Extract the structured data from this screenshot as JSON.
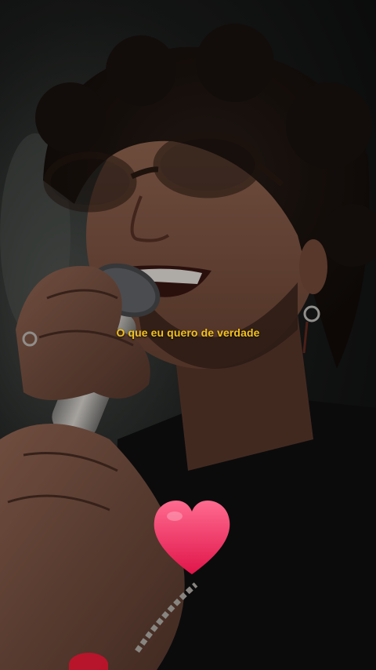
{
  "caption": {
    "text": "O que eu quero de verdade",
    "color": "#f4c21c"
  },
  "photo": {
    "subject": "performer-photo"
  },
  "overlay_icons": {
    "heart": "heart-icon"
  },
  "colors": {
    "heart_top": "#ff5f86",
    "heart_bottom": "#e0154a",
    "background": "#0c0c0e"
  }
}
